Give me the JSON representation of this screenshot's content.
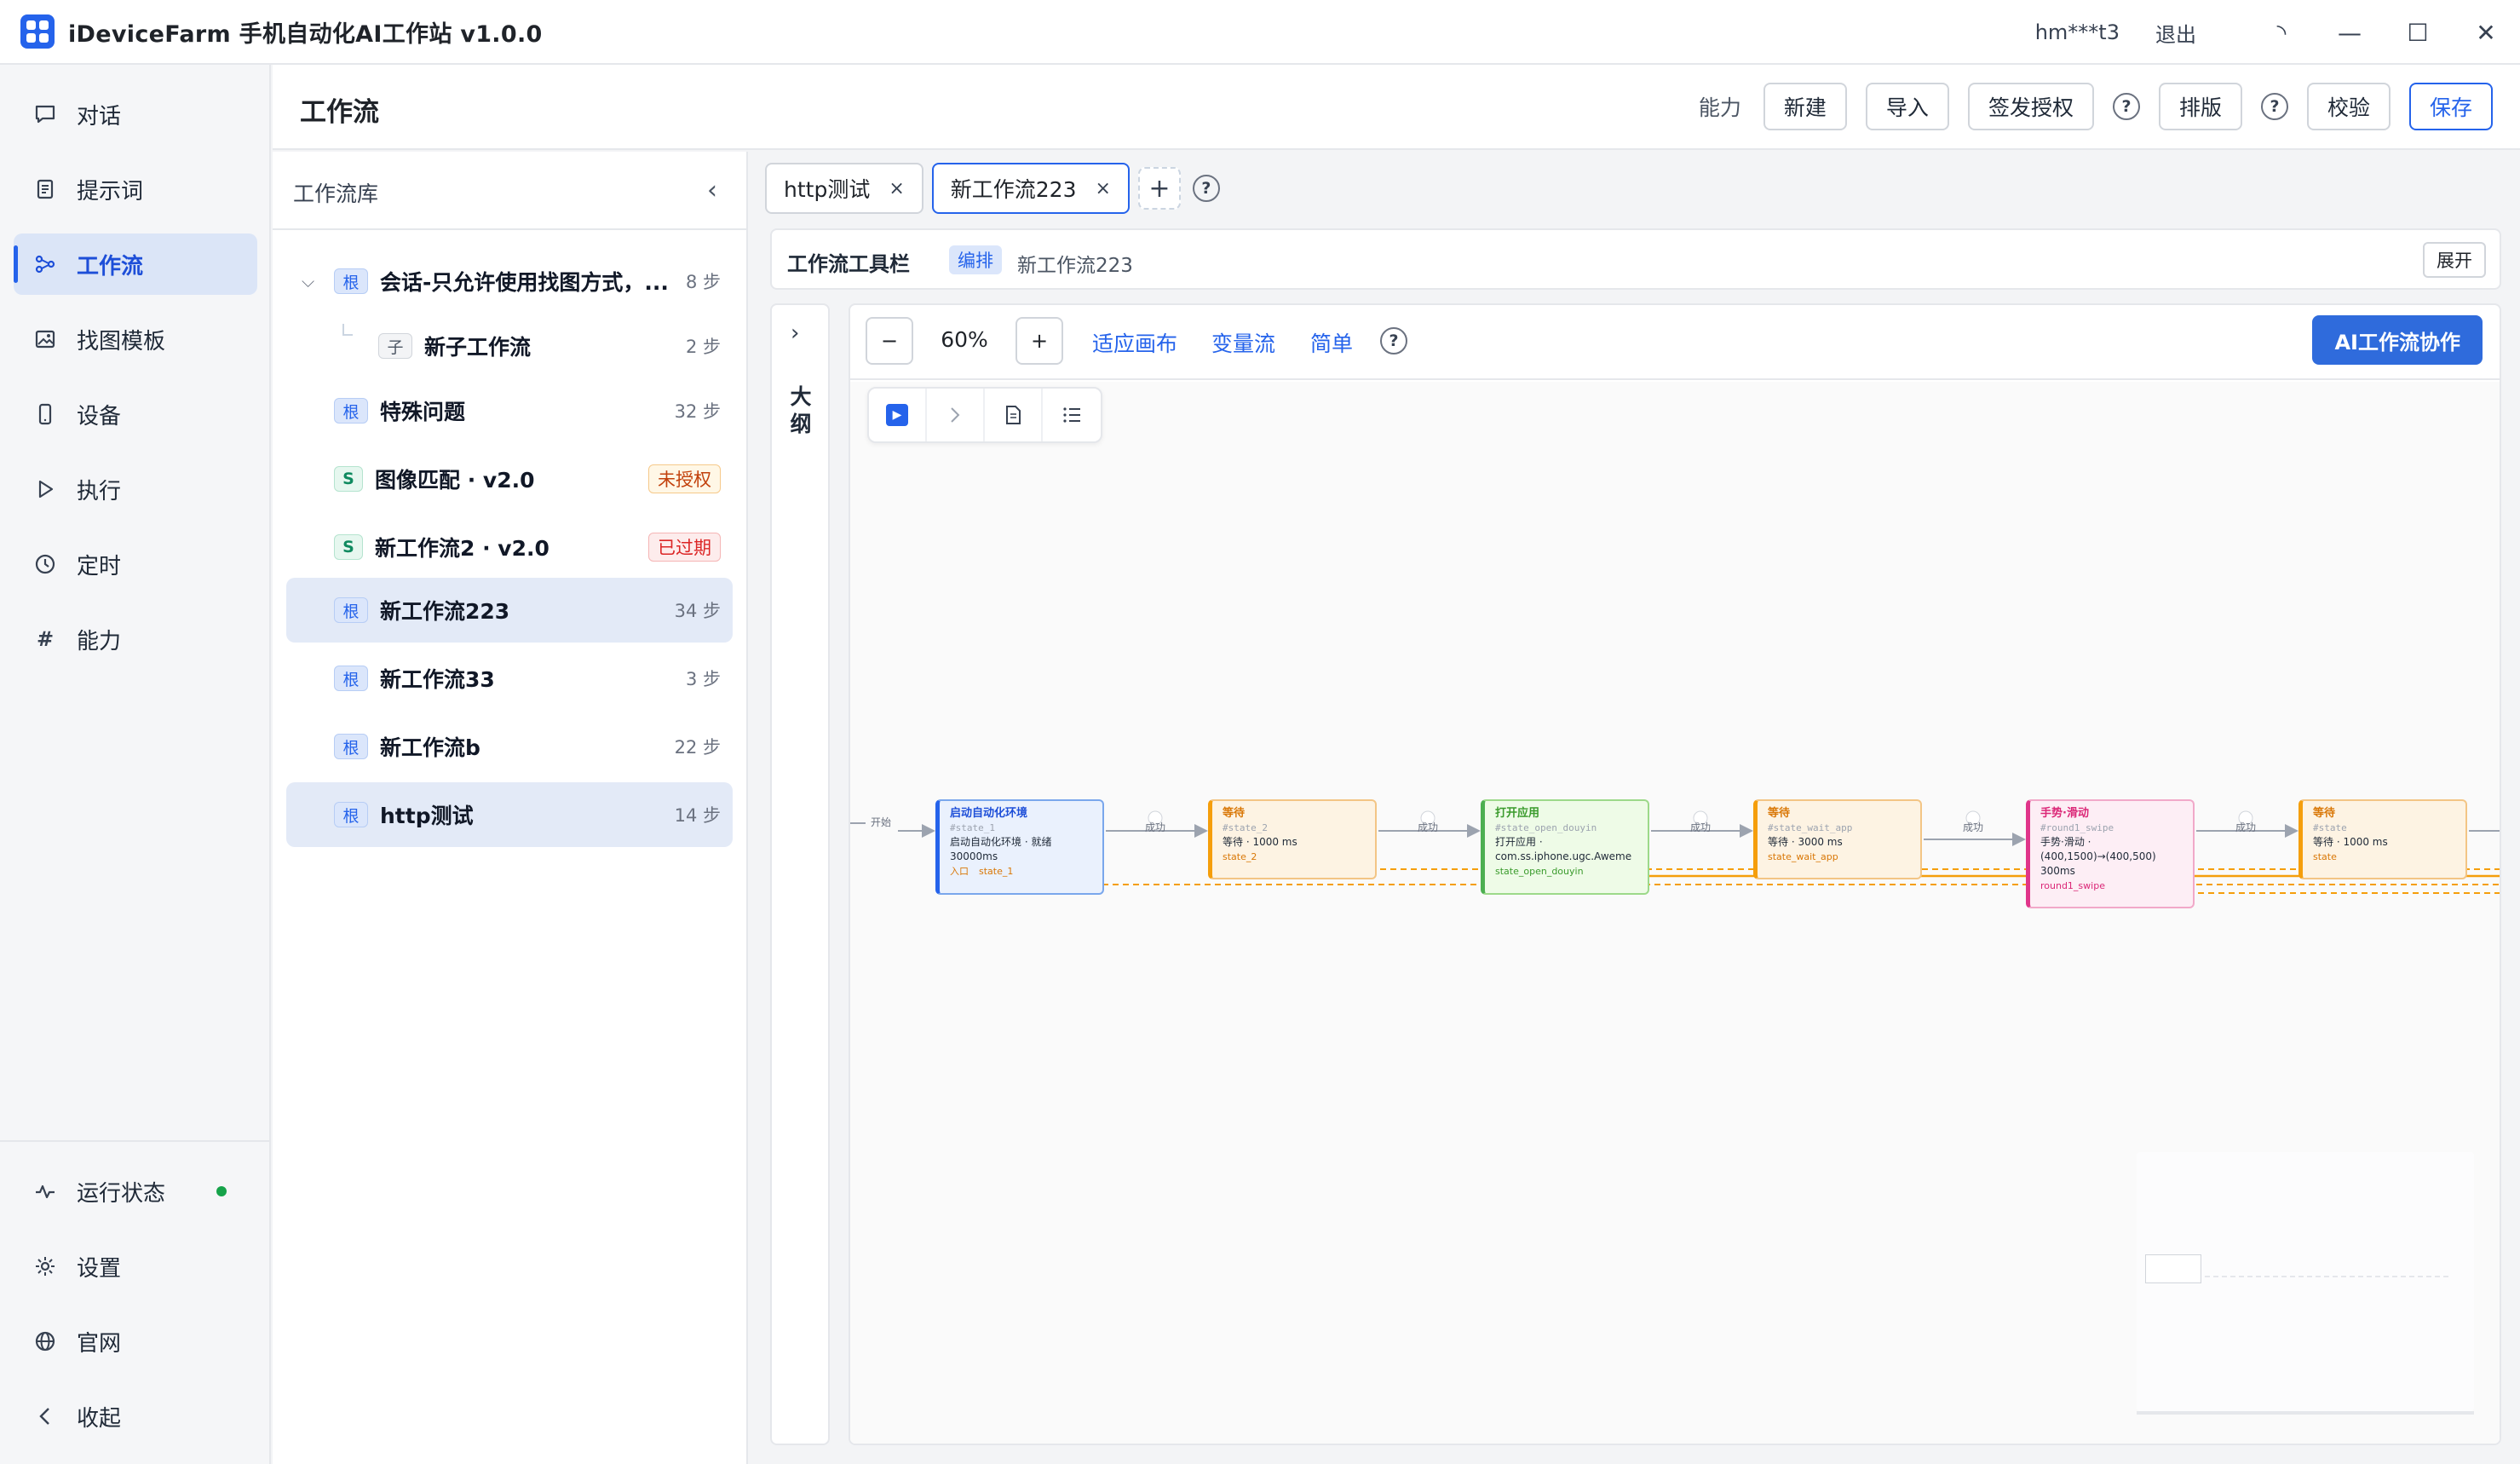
{
  "app": {
    "title": "iDeviceFarm 手机自动化AI工作站 v1.0.0",
    "user": "hm***t3",
    "logout": "退出"
  },
  "nav": {
    "items": [
      {
        "label": "对话",
        "icon": "chat-icon"
      },
      {
        "label": "提示词",
        "icon": "document-icon"
      },
      {
        "label": "工作流",
        "icon": "workflow-icon",
        "active": true
      },
      {
        "label": "找图模板",
        "icon": "image-icon"
      },
      {
        "label": "设备",
        "icon": "phone-icon"
      },
      {
        "label": "执行",
        "icon": "play-icon"
      },
      {
        "label": "定时",
        "icon": "clock-icon"
      },
      {
        "label": "能力",
        "icon": "hash-icon"
      }
    ],
    "bottom": [
      {
        "label": "运行状态",
        "icon": "pulse-icon",
        "status_color": "#16a34a"
      },
      {
        "label": "设置",
        "icon": "settings-icon"
      },
      {
        "label": "官网",
        "icon": "globe-icon"
      },
      {
        "label": "收起",
        "icon": "chevron-left-icon"
      }
    ]
  },
  "header": {
    "title": "工作流",
    "capability_label": "能力",
    "new": "新建",
    "import": "导入",
    "sign": "签发授权",
    "layout": "排版",
    "validate": "校验",
    "save": "保存",
    "help": "?"
  },
  "library": {
    "title": "工作流库",
    "items": [
      {
        "tag": "根",
        "name": "会话-只允许使用找图方式，...",
        "steps": "8 步",
        "expanded": true
      },
      {
        "tag": "子",
        "name": "新子工作流",
        "steps": "2 步"
      },
      {
        "tag": "根",
        "name": "特殊问题",
        "steps": "32 步"
      },
      {
        "tag": "S",
        "name": "图像匹配 · v2.0",
        "badge": "未授权"
      },
      {
        "tag": "S",
        "name": "新工作流2 · v2.0",
        "badge": "已过期"
      },
      {
        "tag": "根",
        "name": "新工作流223",
        "steps": "34 步",
        "selected": true
      },
      {
        "tag": "根",
        "name": "新工作流33",
        "steps": "3 步"
      },
      {
        "tag": "根",
        "name": "新工作流b",
        "steps": "22 步"
      },
      {
        "tag": "根",
        "name": "http测试",
        "steps": "14 步",
        "selected": true
      }
    ]
  },
  "tabs": [
    {
      "label": "http测试",
      "close": "×"
    },
    {
      "label": "新工作流223",
      "close": "×",
      "active": true
    }
  ],
  "tab_add": "+",
  "toolbar": {
    "title": "工作流工具栏",
    "mode": "编排",
    "name": "新工作流223",
    "expand": "展开"
  },
  "outline": {
    "label": "大纲",
    "arrow": "›"
  },
  "canvas_toolbar": {
    "minus": "−",
    "zoom": "60%",
    "plus": "+",
    "fit": "适应画布",
    "var_flow": "变量流",
    "simple": "简单",
    "ai": "AI工作流协作"
  },
  "flow": {
    "start": "开始",
    "edge": "成功",
    "nodes": [
      {
        "title": "启动自动化环境",
        "id": "#state_1",
        "body": "启动自动化环境 · 就绪 30000ms",
        "entry": "入口",
        "foot": "state_1",
        "kind": "blue"
      },
      {
        "title": "等待",
        "id": "#state_2",
        "body": "等待 · 1000 ms",
        "foot": "state_2",
        "kind": "orange"
      },
      {
        "title": "打开应用",
        "id": "#state_open_douyin",
        "body": "打开应用 · com.ss.iphone.ugc.Aweme",
        "foot": "state_open_douyin",
        "kind": "green"
      },
      {
        "title": "等待",
        "id": "#state_wait_app",
        "body": "等待 · 3000 ms",
        "foot": "state_wait_app",
        "kind": "orange"
      },
      {
        "title": "手势·滑动",
        "id": "#round1_swipe",
        "body": "手势·滑动 · (400,1500)→(400,500) 300ms",
        "foot": "round1_swipe",
        "kind": "pink"
      },
      {
        "title": "等待",
        "id": "#state",
        "body": "等待 · 1000 ms",
        "foot": "state",
        "kind": "orange"
      }
    ]
  }
}
